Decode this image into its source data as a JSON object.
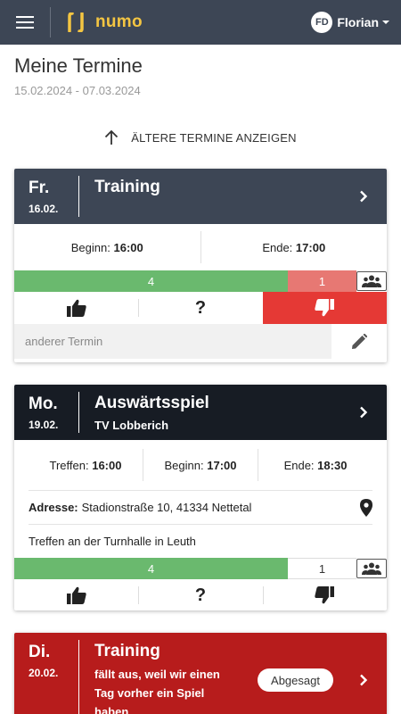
{
  "app": {
    "name": "numo",
    "brand_color": "#f4c542",
    "bar_color": "#3d4655"
  },
  "user": {
    "initials": "FD",
    "name": "Florian"
  },
  "page": {
    "title": "Meine Termine",
    "range": "15.02.2024 - 07.03.2024"
  },
  "older_link": {
    "label": "ÄLTERE TERMINE ANZEIGEN",
    "icon": "arrow-up-icon"
  },
  "events": [
    {
      "weekday": "Fr.",
      "date": "16.02.",
      "title": "Training",
      "header_color": "#3d4655",
      "times": [
        {
          "label": "Beginn:",
          "value": "16:00"
        },
        {
          "label": "Ende:",
          "value": "17:00"
        }
      ],
      "responses": {
        "yes": 4,
        "no": 1
      },
      "my_vote": "no",
      "reason_placeholder": "anderer Termin"
    },
    {
      "weekday": "Mo.",
      "date": "19.02.",
      "title": "Auswärtsspiel",
      "subtitle": "TV Lobberich",
      "header_color": "#171c24",
      "times": [
        {
          "label": "Treffen:",
          "value": "16:00"
        },
        {
          "label": "Beginn:",
          "value": "17:00"
        },
        {
          "label": "Ende:",
          "value": "18:30"
        }
      ],
      "address_label": "Adresse:",
      "address": "Stadionstraße 10, 41334 Nettetal",
      "note": "Treffen an der Turnhalle in Leuth",
      "responses": {
        "yes": 4,
        "open": 1
      }
    },
    {
      "weekday": "Di.",
      "date": "20.02.",
      "title": "Training",
      "header_color": "#b71c1c",
      "subtitle_lines": [
        "fällt aus, weil wir einen",
        "Tag vorher ein Spiel",
        "haben"
      ],
      "status_badge": "Abgesagt"
    }
  ]
}
